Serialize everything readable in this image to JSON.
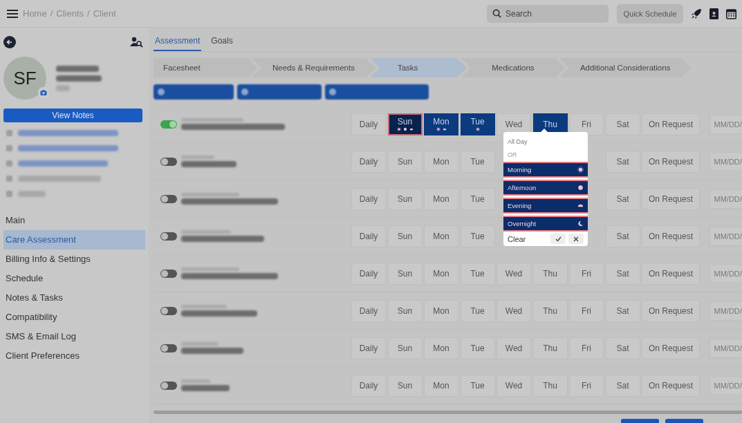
{
  "topbar": {
    "breadcrumb": [
      "Home",
      "Clients",
      "Client"
    ],
    "separator": "/",
    "search": {
      "placeholder": "Search"
    },
    "quick_schedule": "Quick Schedule"
  },
  "client": {
    "initials": "SF",
    "view_notes": "View Notes"
  },
  "sidebar": {
    "items": [
      {
        "label": "Main",
        "selected": false
      },
      {
        "label": "Care Assessment",
        "selected": true
      },
      {
        "label": "Billing Info & Settings",
        "selected": false
      },
      {
        "label": "Schedule",
        "selected": false
      },
      {
        "label": "Notes & Tasks",
        "selected": false
      },
      {
        "label": "Compatibility",
        "selected": false
      },
      {
        "label": "SMS & Email Log",
        "selected": false
      },
      {
        "label": "Client Preferences",
        "selected": false
      }
    ]
  },
  "tabs": [
    {
      "label": "Assessment",
      "selected": true
    },
    {
      "label": "Goals",
      "selected": false
    }
  ],
  "steps": [
    {
      "label": "Facesheet",
      "selected": false
    },
    {
      "label": "Needs & Requirements",
      "selected": false
    },
    {
      "label": "Tasks",
      "selected": true
    },
    {
      "label": "Medications",
      "selected": false
    },
    {
      "label": "Additional Considerations",
      "selected": false
    }
  ],
  "tasks": [
    {
      "enabled": true,
      "covered": false,
      "days": [
        {
          "label": "Daily",
          "selected": false
        },
        {
          "label": "Sun",
          "selected": true,
          "focused": true,
          "morning": true,
          "afternoon": true,
          "evening": true
        },
        {
          "label": "Mon",
          "selected": true,
          "morning": true,
          "evening": true
        },
        {
          "label": "Tue",
          "selected": true,
          "morning": true
        },
        {
          "label": "Wed",
          "selected": false
        },
        {
          "label": "Thu",
          "selected": true
        },
        {
          "label": "Fri",
          "selected": false
        },
        {
          "label": "Sat",
          "selected": false
        }
      ],
      "on_request": "On Request",
      "date": {
        "placeholder": "MM/DD/"
      }
    },
    {
      "enabled": false,
      "covered": true,
      "days": [
        {
          "label": "Daily",
          "selected": false
        },
        {
          "label": "Sun",
          "selected": false
        },
        {
          "label": "Mon",
          "selected": false
        },
        {
          "label": "Tue",
          "selected": false
        },
        {
          "label": "Sat",
          "selected": false
        }
      ],
      "on_request": "On Request",
      "date": {
        "placeholder": "MM/DD/"
      }
    },
    {
      "enabled": false,
      "covered": true,
      "days": [
        {
          "label": "Daily",
          "selected": false
        },
        {
          "label": "Sun",
          "selected": false
        },
        {
          "label": "Mon",
          "selected": false
        },
        {
          "label": "Tue",
          "selected": false
        },
        {
          "label": "Sat",
          "selected": false
        }
      ],
      "on_request": "On Request",
      "date": {
        "placeholder": "MM/DD/"
      }
    },
    {
      "enabled": false,
      "covered": true,
      "days": [
        {
          "label": "Daily",
          "selected": false
        },
        {
          "label": "Sun",
          "selected": false
        },
        {
          "label": "Mon",
          "selected": false
        },
        {
          "label": "Tue",
          "selected": false
        },
        {
          "label": "Sat",
          "selected": false
        }
      ],
      "on_request": "On Request",
      "date": {
        "placeholder": "MM/DD/"
      }
    },
    {
      "enabled": false,
      "covered": false,
      "days": [
        {
          "label": "Daily",
          "selected": false
        },
        {
          "label": "Sun",
          "selected": false
        },
        {
          "label": "Mon",
          "selected": false
        },
        {
          "label": "Tue",
          "selected": false
        },
        {
          "label": "Wed",
          "selected": false
        },
        {
          "label": "Thu",
          "selected": false
        },
        {
          "label": "Fri",
          "selected": false
        },
        {
          "label": "Sat",
          "selected": false
        }
      ],
      "on_request": "On Request",
      "date": {
        "placeholder": "MM/DD/"
      }
    },
    {
      "enabled": false,
      "covered": false,
      "days": [
        {
          "label": "Daily",
          "selected": false
        },
        {
          "label": "Sun",
          "selected": false
        },
        {
          "label": "Mon",
          "selected": false
        },
        {
          "label": "Tue",
          "selected": false
        },
        {
          "label": "Wed",
          "selected": false
        },
        {
          "label": "Thu",
          "selected": false
        },
        {
          "label": "Fri",
          "selected": false
        },
        {
          "label": "Sat",
          "selected": false
        }
      ],
      "on_request": "On Request",
      "date": {
        "placeholder": "MM/DD/"
      }
    },
    {
      "enabled": false,
      "covered": false,
      "days": [
        {
          "label": "Daily",
          "selected": false
        },
        {
          "label": "Sun",
          "selected": false
        },
        {
          "label": "Mon",
          "selected": false
        },
        {
          "label": "Tue",
          "selected": false
        },
        {
          "label": "Wed",
          "selected": false
        },
        {
          "label": "Thu",
          "selected": false
        },
        {
          "label": "Fri",
          "selected": false
        },
        {
          "label": "Sat",
          "selected": false
        }
      ],
      "on_request": "On Request",
      "date": {
        "placeholder": "MM/DD/"
      }
    },
    {
      "enabled": false,
      "covered": false,
      "days": [
        {
          "label": "Daily",
          "selected": false
        },
        {
          "label": "Sun",
          "selected": false
        },
        {
          "label": "Mon",
          "selected": false
        },
        {
          "label": "Tue",
          "selected": false
        },
        {
          "label": "Wed",
          "selected": false
        },
        {
          "label": "Thu",
          "selected": false
        },
        {
          "label": "Fri",
          "selected": false
        },
        {
          "label": "Sat",
          "selected": false
        }
      ],
      "on_request": "On Request",
      "date": {
        "placeholder": "MM/DD/"
      }
    }
  ],
  "time_popup": {
    "all_day": "All Day",
    "or": "OR",
    "periods": [
      {
        "kind": "morning",
        "label": "Morning",
        "selected": true
      },
      {
        "kind": "afternoon",
        "label": "Afternoon",
        "selected": true
      },
      {
        "kind": "evening",
        "label": "Evening",
        "selected": true
      },
      {
        "kind": "overnight",
        "label": "Overnight",
        "selected": true
      }
    ],
    "clear": "Clear"
  }
}
